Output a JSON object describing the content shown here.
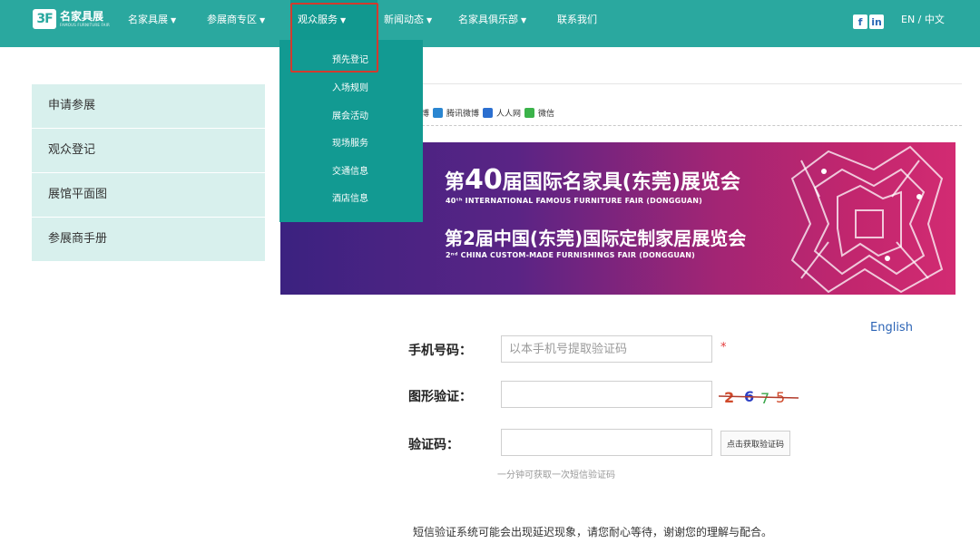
{
  "logo": {
    "badge": "3F",
    "cn": "名家具展",
    "en": "FAMOUS FURNITURE FAIR"
  },
  "nav": {
    "items": [
      {
        "label": "名家具展",
        "caret": "▼"
      },
      {
        "label": "参展商专区",
        "caret": "▼"
      },
      {
        "label": "观众服务",
        "caret": "▼"
      },
      {
        "label": "新闻动态",
        "caret": "▼"
      },
      {
        "label": "名家具俱乐部",
        "caret": "▼"
      },
      {
        "label": "联系我们",
        "caret": ""
      }
    ],
    "social": [
      {
        "icon": "facebook-icon",
        "glyph": "f"
      },
      {
        "icon": "linkedin-icon",
        "glyph": "in"
      }
    ],
    "lang": "EN  /  中文"
  },
  "dropdown": {
    "items": [
      "预先登记",
      "入场规则",
      "展会活动",
      "现场服务",
      "交通信息",
      "酒店信息"
    ]
  },
  "sidebar": {
    "items": [
      "申请参展",
      "观众登记",
      "展馆平面图",
      "参展商手册"
    ]
  },
  "share": {
    "items": [
      "微博",
      "腾讯微博",
      "人人网",
      "微信"
    ]
  },
  "banner": {
    "line1_pre": "第",
    "line1_num": "40",
    "line1_post": "届国际名家具(东莞)展览会",
    "sub1": "40ᵗʰ INTERNATIONAL FAMOUS FURNITURE FAIR (DONGGUAN)",
    "line2": "第2届中国(东莞)国际定制家居展览会",
    "sub2": "2ⁿᵈ CHINA CUSTOM-MADE FURNISHINGS FAIR (DONGGUAN)"
  },
  "form": {
    "english_link": "English",
    "phone_label": "手机号码：",
    "phone_placeholder": "以本手机号提取验证码",
    "required_mark": "*",
    "captcha_label": "图形验证：",
    "captcha_chars": [
      "2",
      "6",
      "7",
      "5"
    ],
    "code_label": "验证码：",
    "sms_button": "点击获取验证码",
    "hint": "一分钟可获取一次短信验证码",
    "note": "短信验证系统可能会出现延迟现象，请您耐心等待，谢谢您的理解与配合。"
  },
  "colors": {
    "nav_bg": "#2aa89f",
    "dropdown_bg": "#129a92",
    "sidebar_bg": "#d8f0ed",
    "highlight": "#d23b2e",
    "link": "#2b63b5"
  }
}
